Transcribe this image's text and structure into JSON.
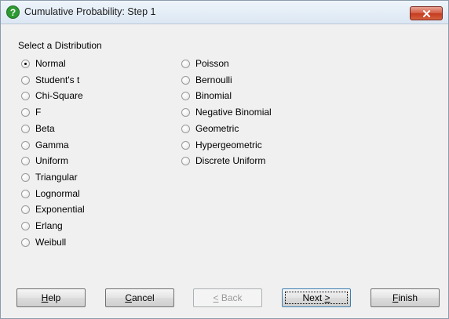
{
  "window": {
    "title": "Cumulative Probability: Step 1",
    "title_icon": "help-question-icon",
    "close_icon": "close-x-icon",
    "close_color": "#c94a2f",
    "icon_color": "#2d9a32"
  },
  "group": {
    "label": "Select a Distribution",
    "selected": "Normal",
    "left_column": [
      {
        "label": "Normal",
        "checked": true
      },
      {
        "label": "Student's t",
        "checked": false
      },
      {
        "label": "Chi-Square",
        "checked": false
      },
      {
        "label": "F",
        "checked": false
      },
      {
        "label": "Beta",
        "checked": false
      },
      {
        "label": "Gamma",
        "checked": false
      },
      {
        "label": "Uniform",
        "checked": false
      },
      {
        "label": "Triangular",
        "checked": false
      },
      {
        "label": "Lognormal",
        "checked": false
      },
      {
        "label": "Exponential",
        "checked": false
      },
      {
        "label": "Erlang",
        "checked": false
      },
      {
        "label": "Weibull",
        "checked": false
      }
    ],
    "right_column": [
      {
        "label": "Poisson",
        "checked": false
      },
      {
        "label": "Bernoulli",
        "checked": false
      },
      {
        "label": "Binomial",
        "checked": false
      },
      {
        "label": "Negative Binomial",
        "checked": false
      },
      {
        "label": "Geometric",
        "checked": false
      },
      {
        "label": "Hypergeometric",
        "checked": false
      },
      {
        "label": "Discrete Uniform",
        "checked": false
      }
    ]
  },
  "buttons": {
    "help": {
      "prefix": "",
      "mnemonic": "H",
      "rest": "elp"
    },
    "cancel": {
      "prefix": "",
      "mnemonic": "C",
      "rest": "ancel"
    },
    "back": {
      "prefix": "",
      "mnemonic": "<",
      "rest": " Back",
      "disabled": true
    },
    "next": {
      "prefix": "Next ",
      "mnemonic": ">",
      "rest": ""
    },
    "finish": {
      "prefix": "",
      "mnemonic": "F",
      "rest": "inish"
    }
  }
}
